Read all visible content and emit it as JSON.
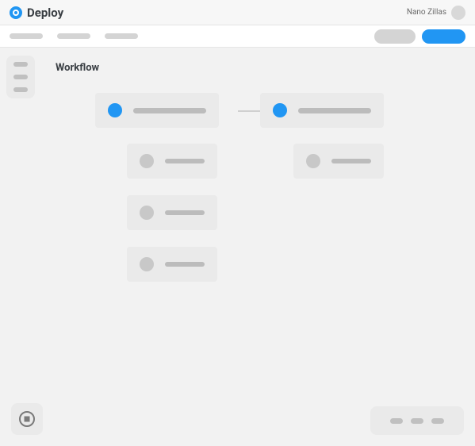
{
  "app": {
    "title": "Deploy"
  },
  "user": {
    "name": "Nano Zillas"
  },
  "colors": {
    "accent": "#2196f3",
    "placeholder": "#d4d4d4"
  },
  "secnav": {
    "items": [
      {
        "label": ""
      },
      {
        "label": ""
      },
      {
        "label": ""
      }
    ],
    "actions": [
      {
        "label": "",
        "variant": "gray"
      },
      {
        "label": "",
        "variant": "blue"
      }
    ]
  },
  "sidebar": {
    "items": [
      {
        "label": ""
      },
      {
        "label": ""
      },
      {
        "label": ""
      }
    ]
  },
  "content": {
    "title": "Workflow",
    "nodes": [
      {
        "id": "n0",
        "label": "",
        "status": "active",
        "size": "lg"
      },
      {
        "id": "n1",
        "label": "",
        "status": "active",
        "size": "lg"
      },
      {
        "id": "n2",
        "label": "",
        "status": "idle",
        "size": "sm"
      },
      {
        "id": "n3",
        "label": "",
        "status": "idle",
        "size": "sm"
      },
      {
        "id": "n4",
        "label": "",
        "status": "idle",
        "size": "sm"
      },
      {
        "id": "n5",
        "label": "",
        "status": "idle",
        "size": "sm"
      }
    ],
    "connectors": [
      {
        "from": "n0",
        "to": "n1"
      }
    ]
  },
  "bottom_left": {
    "icon": "stop-icon"
  },
  "bottom_right": {
    "items": [
      {
        "label": ""
      },
      {
        "label": ""
      },
      {
        "label": ""
      }
    ]
  }
}
